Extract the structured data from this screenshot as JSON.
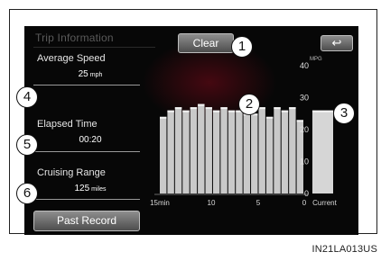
{
  "screen": {
    "title": "Trip Information",
    "clear_label": "Clear",
    "back_label": "↩",
    "past_record_label": "Past Record"
  },
  "stats": {
    "average_speed": {
      "label": "Average Speed",
      "value": "25",
      "unit": "mph"
    },
    "elapsed_time": {
      "label": "Elapsed Time",
      "value": "00:20"
    },
    "cruising_range": {
      "label": "Cruising Range",
      "value": "125",
      "unit": "miles"
    }
  },
  "callouts": [
    "1",
    "2",
    "3",
    "4",
    "5",
    "6"
  ],
  "chart_data": {
    "type": "bar",
    "unit_label": "MPG",
    "y_ticks": [
      "40",
      "30",
      "20",
      "10",
      "0"
    ],
    "ylim": [
      0,
      40
    ],
    "x_ticks": [
      "15min",
      "10",
      "5",
      "0"
    ],
    "values": [
      24,
      26,
      27,
      26,
      27,
      28,
      27,
      26,
      27,
      26,
      26,
      25,
      25,
      27,
      24,
      27,
      26,
      27,
      23
    ],
    "current_label": "Current",
    "current_value": 26
  },
  "figure_id": "IN21LA013US"
}
